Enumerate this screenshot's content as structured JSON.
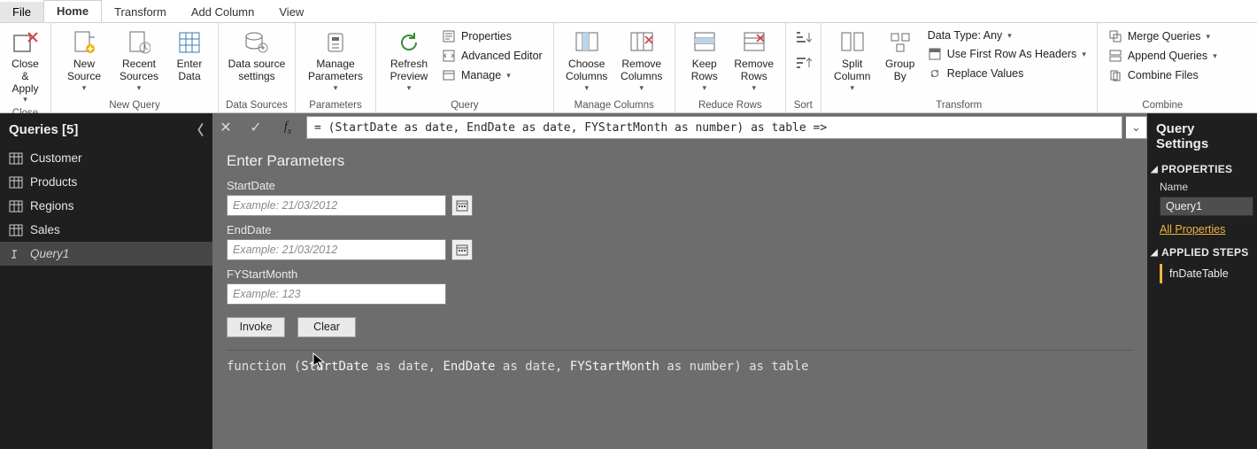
{
  "tabs": {
    "file": "File",
    "home": "Home",
    "transform": "Transform",
    "addcol": "Add Column",
    "view": "View"
  },
  "ribbon": {
    "close": {
      "closeApply": "Close &\nApply",
      "group": "Close"
    },
    "newQuery": {
      "newSource": "New\nSource",
      "recentSources": "Recent\nSources",
      "enterData": "Enter\nData",
      "group": "New Query"
    },
    "dataSources": {
      "settings": "Data source\nsettings",
      "group": "Data Sources"
    },
    "parameters": {
      "manage": "Manage\nParameters",
      "group": "Parameters"
    },
    "query": {
      "refresh": "Refresh\nPreview",
      "properties": "Properties",
      "advEditor": "Advanced Editor",
      "manage": "Manage",
      "group": "Query"
    },
    "manageCols": {
      "choose": "Choose\nColumns",
      "remove": "Remove\nColumns",
      "group": "Manage Columns"
    },
    "reduce": {
      "keep": "Keep\nRows",
      "removeRows": "Remove\nRows",
      "group": "Reduce Rows"
    },
    "sort": {
      "group": "Sort"
    },
    "split": {
      "split": "Split\nColumn",
      "groupBy": "Group\nBy",
      "dataType": "Data Type: Any",
      "firstRow": "Use First Row As Headers",
      "replace": "Replace Values",
      "group": "Transform"
    },
    "combine": {
      "merge": "Merge Queries",
      "append": "Append Queries",
      "combineFiles": "Combine Files",
      "group": "Combine"
    }
  },
  "queriesPane": {
    "title": "Queries [5]",
    "items": [
      {
        "label": "Customer"
      },
      {
        "label": "Products"
      },
      {
        "label": "Regions"
      },
      {
        "label": "Sales"
      },
      {
        "label": "Query1",
        "selected": true,
        "isFn": true
      }
    ]
  },
  "formulaBar": {
    "text": "= (StartDate as date, EndDate as date, FYStartMonth as number) as table =>"
  },
  "paramPanel": {
    "title": "Enter Parameters",
    "fields": [
      {
        "label": "StartDate",
        "placeholder": "Example: 21/03/2012",
        "hasDatePicker": true
      },
      {
        "label": "EndDate",
        "placeholder": "Example: 21/03/2012",
        "hasDatePicker": true
      },
      {
        "label": "FYStartMonth",
        "placeholder": "Example: 123",
        "hasDatePicker": false
      }
    ],
    "invoke": "Invoke",
    "clear": "Clear"
  },
  "signature": {
    "prefix": "function (",
    "p1": "StartDate",
    "as1": " as date, ",
    "p2": "EndDate",
    "as2": " as date, ",
    "p3": "FYStartMonth",
    "as3": " as number) as table"
  },
  "settings": {
    "title": "Query Settings",
    "propsHeader": "PROPERTIES",
    "nameLabel": "Name",
    "nameValue": "Query1",
    "allProps": "All Properties",
    "stepsHeader": "APPLIED STEPS",
    "step1": "fnDateTable"
  }
}
